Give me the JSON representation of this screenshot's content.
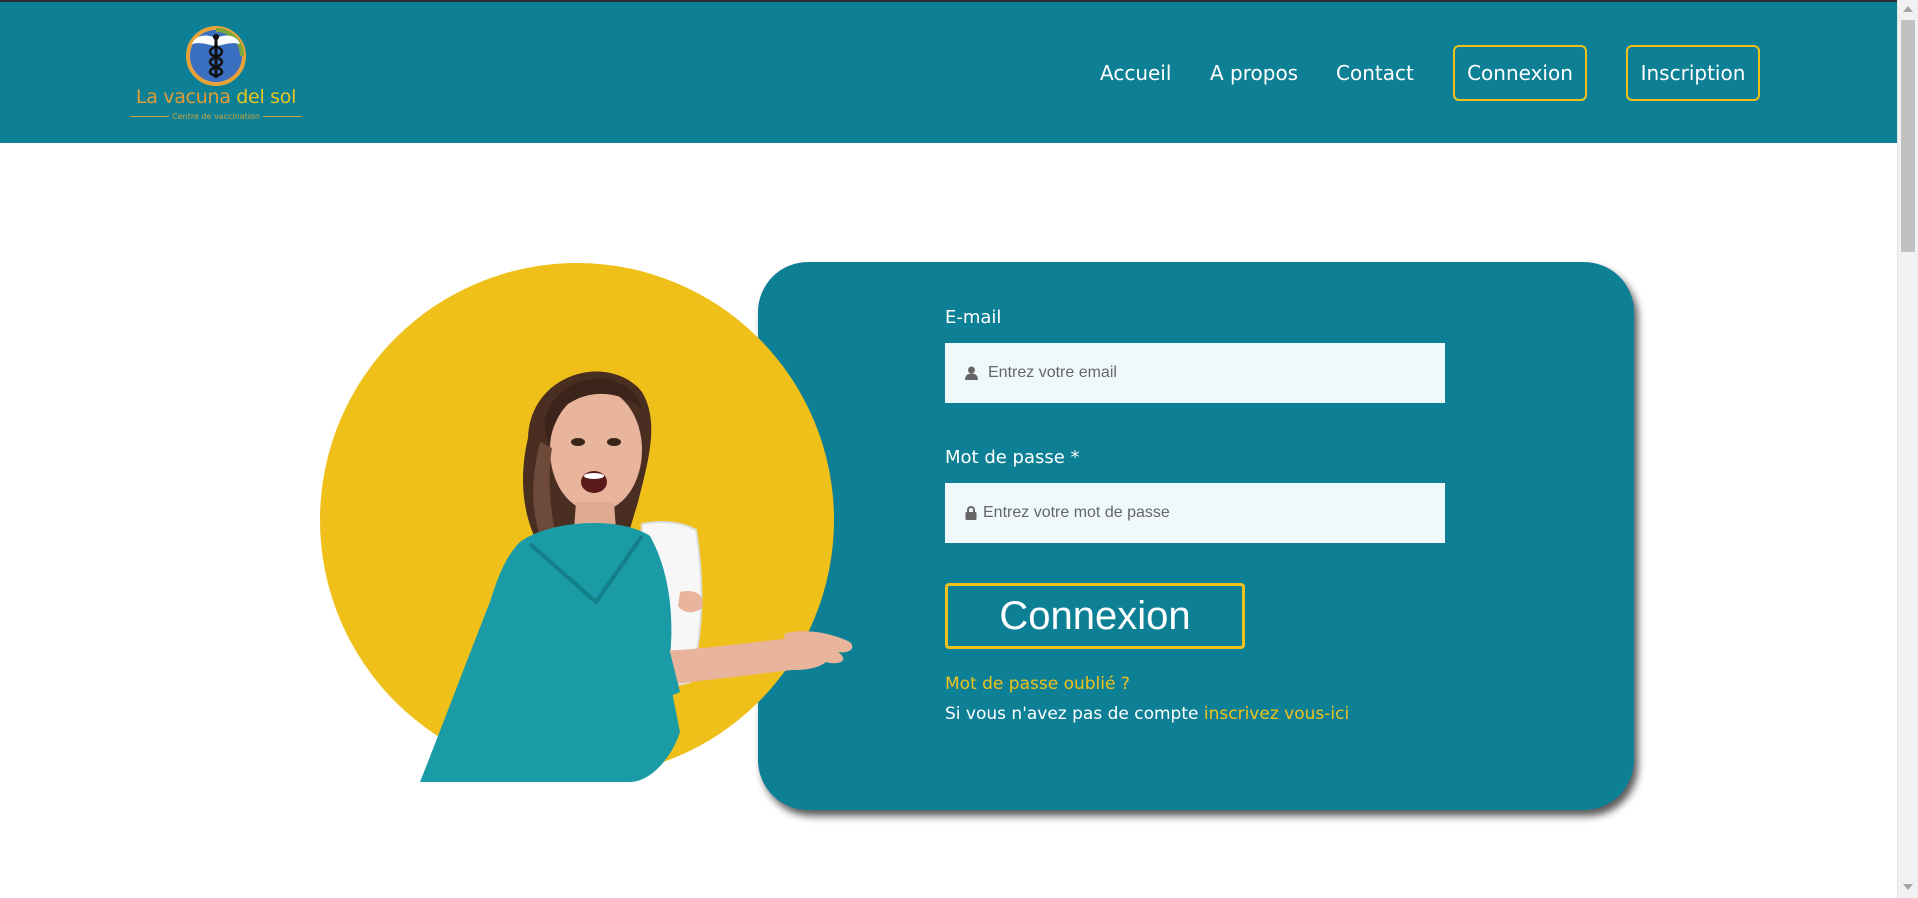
{
  "brand": {
    "name_part1": "La vacuna",
    "name_part2": "del sol",
    "tagline": "Centre de vaccination"
  },
  "nav": {
    "links": [
      {
        "label": "Accueil"
      },
      {
        "label": "A propos"
      },
      {
        "label": "Contact"
      }
    ],
    "buttons": [
      {
        "label": "Connexion"
      },
      {
        "label": "Inscription"
      }
    ]
  },
  "login_form": {
    "email": {
      "label": "E-mail",
      "placeholder": "Entrez votre email",
      "value": "",
      "icon": "user-icon"
    },
    "password": {
      "label": "Mot de passe *",
      "placeholder": "Entrez votre mot de passe",
      "value": "",
      "icon": "lock-icon"
    },
    "submit_label": "Connexion",
    "forgot_label": "Mot de passe oublié ?",
    "signup_prompt": "Si vous n'avez pas de compte",
    "signup_link": "inscrivez vous-ici"
  },
  "colors": {
    "primary": "#0e8096",
    "accent": "#f0c11a",
    "input_bg": "#eff8fa",
    "logo_orange": "#e39b32"
  }
}
